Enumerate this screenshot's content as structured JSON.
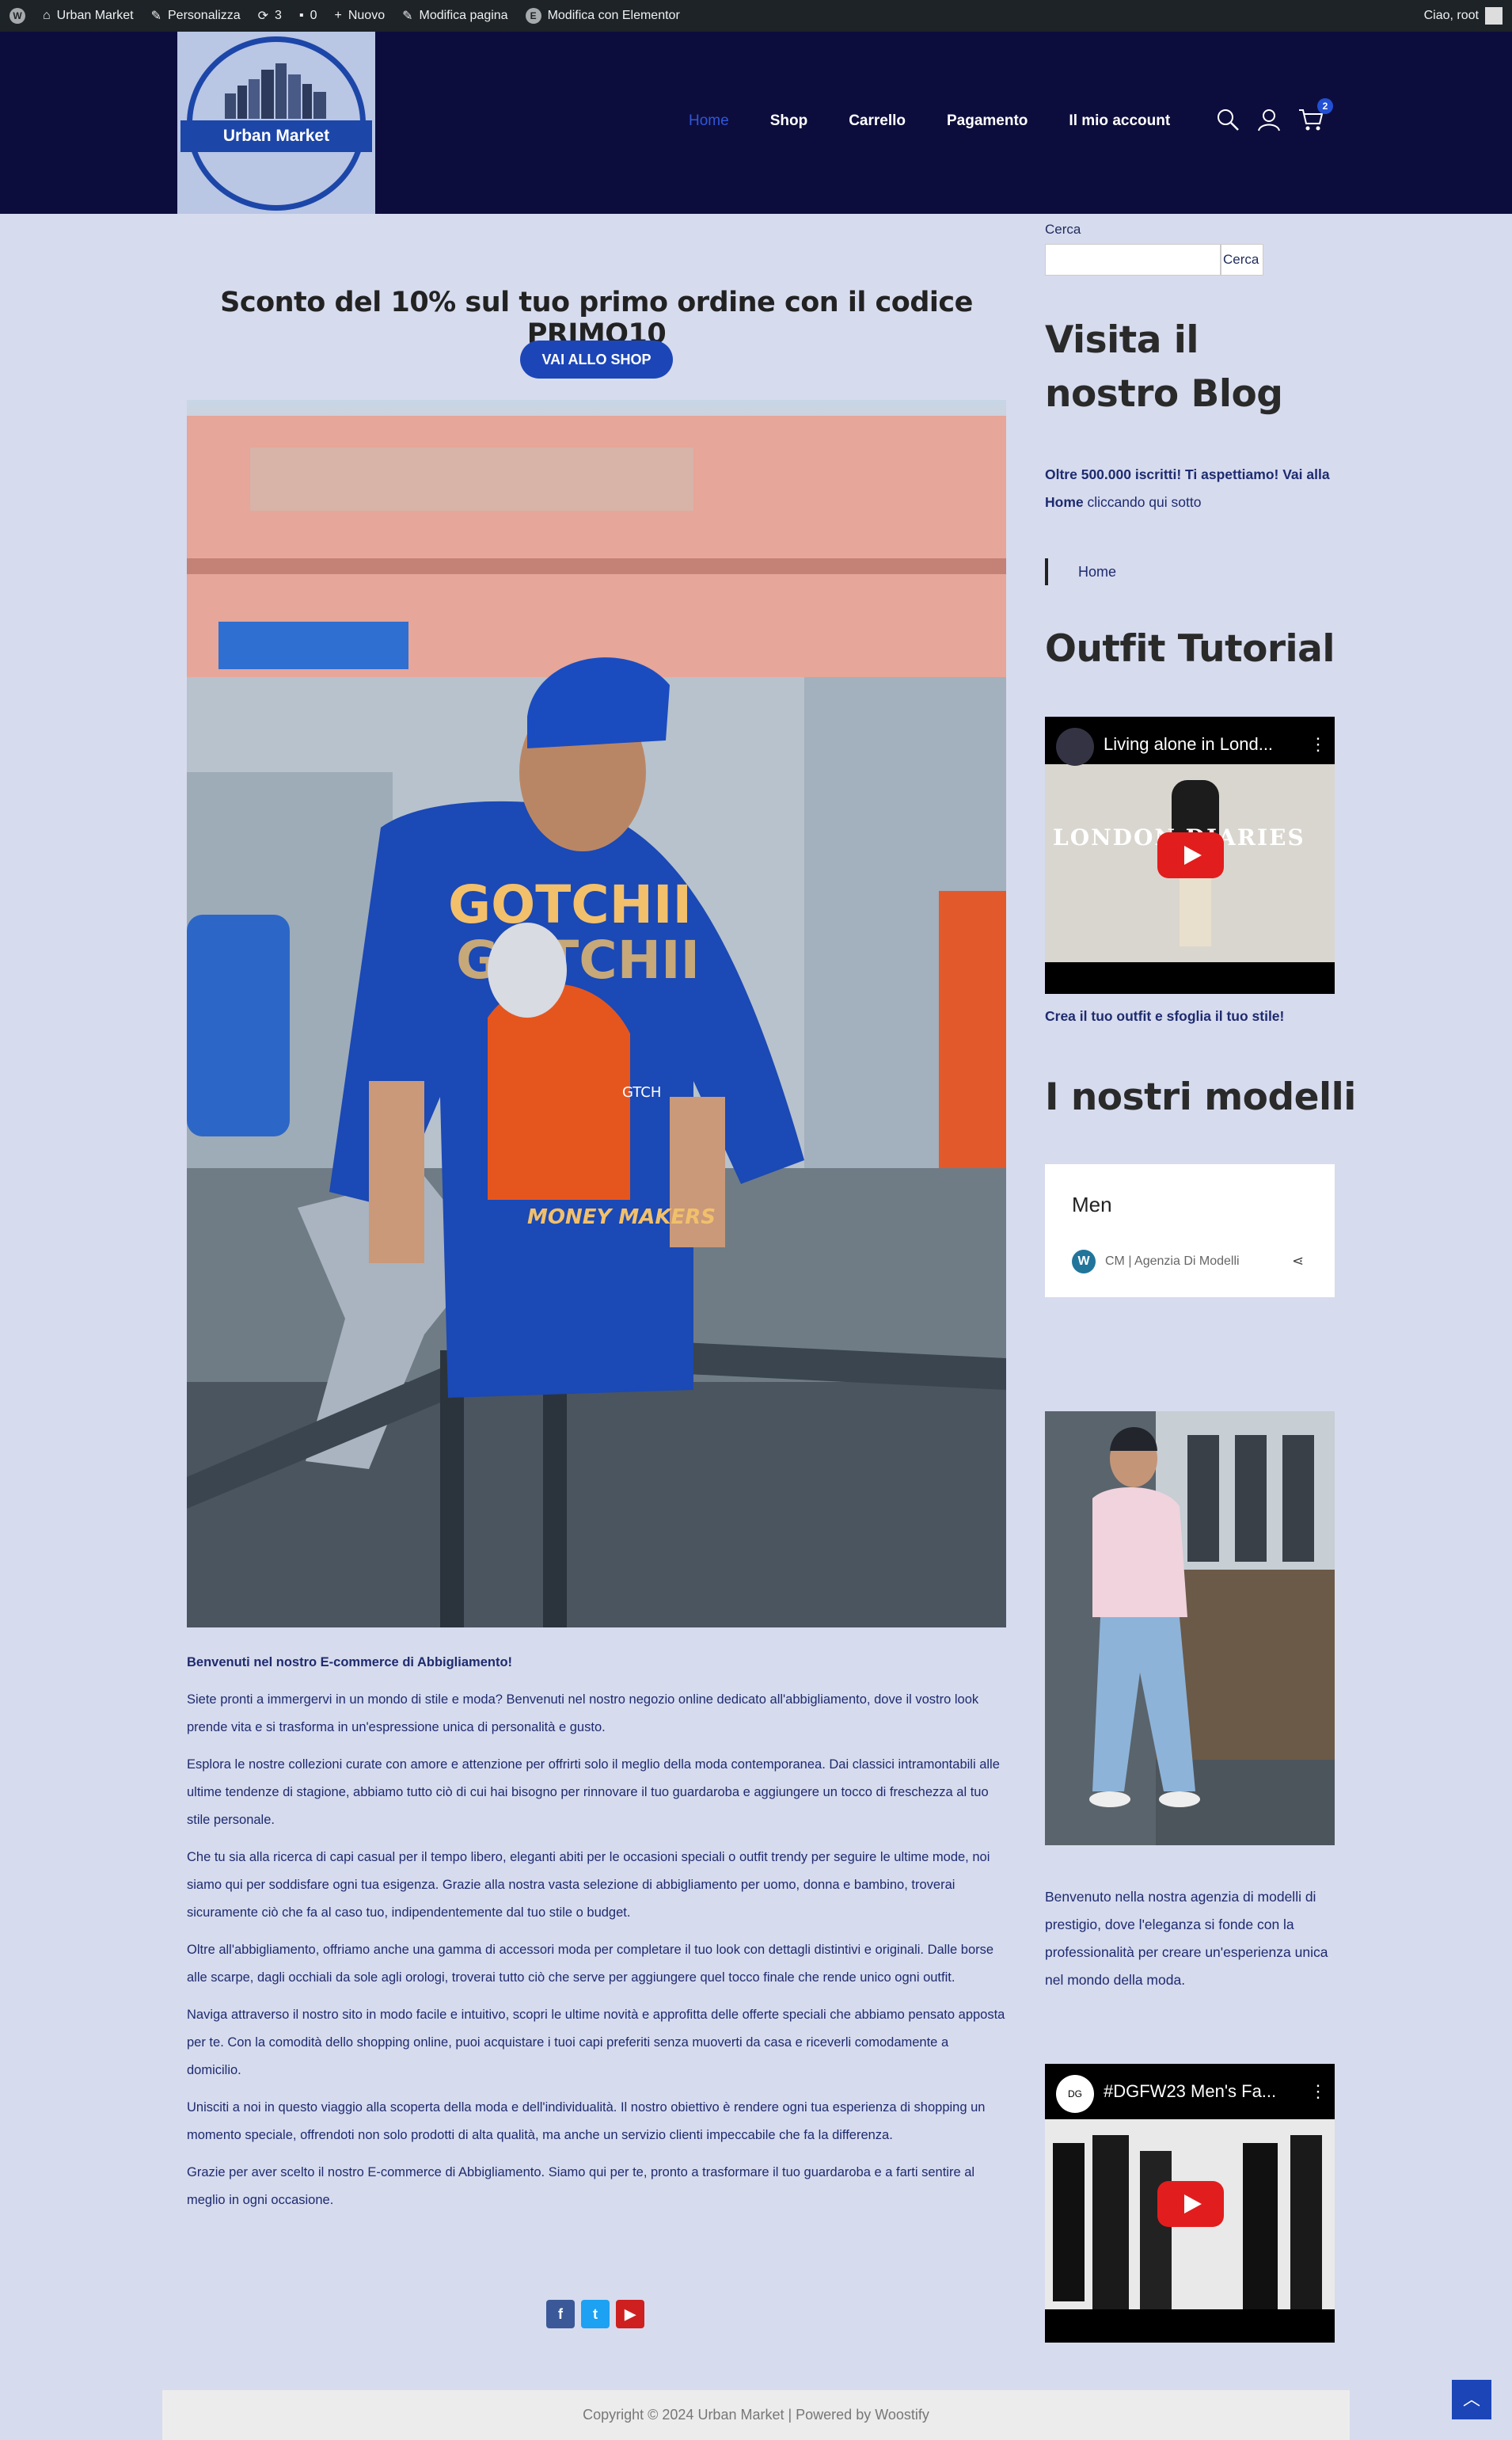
{
  "adminbar": {
    "site": "Urban Market",
    "customize": "Personalizza",
    "updates": "3",
    "comments": "0",
    "new": "Nuovo",
    "edit": "Modifica pagina",
    "elementor": "Modifica con Elementor",
    "greeting": "Ciao, root"
  },
  "header": {
    "logo_text": "Urban Market",
    "nav": [
      "Home",
      "Shop",
      "Carrello",
      "Pagamento",
      "Il mio account"
    ],
    "cart_count": "2"
  },
  "main": {
    "promo": "Sconto del 10% sul tuo primo ordine con il codice PRIMO10",
    "shop_button": "VAI ALLO SHOP",
    "paragraphs": [
      "Benvenuti nel nostro E-commerce di Abbigliamento!",
      "Siete pronti a immergervi in un mondo di stile e moda? Benvenuti nel nostro negozio online dedicato all'abbigliamento, dove il vostro look prende vita e si trasforma in un'espressione unica di personalità e gusto.",
      "Esplora le nostre collezioni curate con amore e attenzione per offrirti solo il meglio della moda contemporanea. Dai classici intramontabili alle ultime tendenze di stagione, abbiamo tutto ciò di cui hai bisogno per rinnovare il tuo guardaroba e aggiungere un tocco di freschezza al tuo stile personale.",
      "Che tu sia alla ricerca di capi casual per il tempo libero, eleganti abiti per le occasioni speciali o outfit trendy per seguire le ultime mode, noi siamo qui per soddisfare ogni tua esigenza. Grazie alla nostra vasta selezione di abbigliamento per uomo, donna e bambino, troverai sicuramente ciò che fa al caso tuo, indipendentemente dal tuo stile o budget.",
      "Oltre all'abbigliamento, offriamo anche una gamma di accessori moda per completare il tuo look con dettagli distintivi e originali. Dalle borse alle scarpe, dagli occhiali da sole agli orologi, troverai tutto ciò che serve per aggiungere quel tocco finale che rende unico ogni outfit.",
      "Naviga attraverso il nostro sito in modo facile e intuitivo, scopri le ultime novità e approfitta delle offerte speciali che abbiamo pensato apposta per te. Con la comodità dello shopping online, puoi acquistare i tuoi capi preferiti senza muoverti da casa e riceverli comodamente a domicilio.",
      "Unisciti a noi in questo viaggio alla scoperta della moda e dell'individualità. Il nostro obiettivo è rendere ogni tua esperienza di shopping un momento speciale, offrendoti non solo prodotti di alta qualità, ma anche un servizio clienti impeccabile che fa la differenza.",
      "Grazie per aver scelto il nostro E-commerce di Abbigliamento. Siamo qui per te, pronto a trasformare il tuo guardaroba e a farti sentire al meglio in ogni occasione."
    ],
    "hero_text_top": "GOTCHII",
    "hero_text_bottom": "MONEY MAKERS",
    "hero_sign": "GTCH"
  },
  "sidebar": {
    "search_label": "Cerca",
    "search_button": "Cerca",
    "blog_title": "Visita il nostro Blog",
    "blog_text_bold": "Oltre 500.000 iscritti! Ti aspettiamo! Vai alla Home",
    "blog_text_rest": " cliccando qui sotto",
    "home_link": "Home",
    "tutorial_title": "Outfit Tutorial",
    "video1_title": "Living alone in Lond...",
    "video1_overlay": "LONDON DIARIES",
    "tutorial_caption": "Crea il tuo outfit e sfoglia il tuo stile!",
    "models_title": "I nostri modelli",
    "card_title": "Men",
    "card_source": "CM | Agenzia Di Modelli",
    "models_text": "Benvenuto nella nostra agenzia di modelli di prestigio, dove l'eleganza si fonde con la professionalità per creare un'esperienza unica nel mondo della moda.",
    "video2_title": "#DGFW23 Men's Fa...",
    "video2_channel": "DG"
  },
  "footer": {
    "copyright": "Copyright © 2024 Urban Market | Powered by Woostify"
  },
  "colors": {
    "accent": "#1c46b8",
    "header_bg": "#0d0d3d",
    "page_bg": "#d6dbee"
  }
}
